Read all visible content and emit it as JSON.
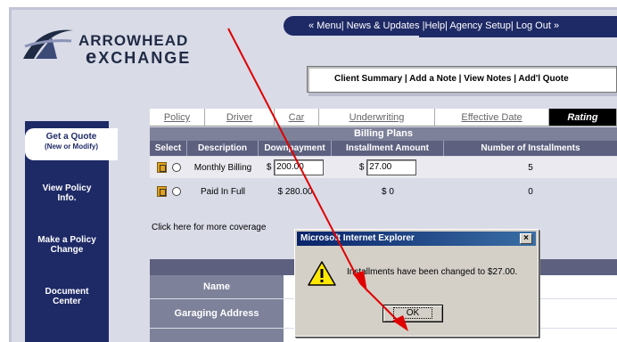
{
  "brand": {
    "line1": "ARROWHEAD",
    "line2": "xCHANGE",
    "line2_first": "e"
  },
  "top_menu": {
    "text": "« Menu| News & Updates |Help| Agency Setup| Log Out »"
  },
  "client_bar": {
    "text": "Client Summary | Add a Note | View Notes | Add'l Quote"
  },
  "sidebar": {
    "items": [
      {
        "label": "Get a Quote",
        "sub": "(New or Modify)"
      },
      {
        "label": "View Policy Info."
      },
      {
        "label": "Make a Policy Change"
      },
      {
        "label": "Document Center"
      }
    ]
  },
  "tabs": [
    {
      "label": "Policy"
    },
    {
      "label": "Driver"
    },
    {
      "label": "Car"
    },
    {
      "label": "Underwriting"
    },
    {
      "label": "Effective Date"
    },
    {
      "label": "Rating"
    }
  ],
  "billing": {
    "title": "Billing Plans",
    "columns": [
      "Select",
      "Description",
      "Downpayment",
      "Installment Amount",
      "Number of Installments"
    ],
    "rows": [
      {
        "description": "Monthly Billing",
        "currency": "$",
        "downpayment": "200.00",
        "installment_currency": "$",
        "installment": "27.00",
        "count": "5"
      },
      {
        "description": "Paid In Full",
        "downpayment_text": "$ 280.00",
        "installment_text": "$ 0",
        "count": "0"
      }
    ]
  },
  "click_here": "Click here for more coverage",
  "lower": {
    "rows": [
      {
        "label": "Name",
        "value": ""
      },
      {
        "label": "Garaging Address",
        "value": ""
      },
      {
        "label": "",
        "value": ""
      }
    ]
  },
  "dialog": {
    "title": "Microsoft Internet Explorer",
    "close": "×",
    "message": "Installments have been changed to $27.00.",
    "ok_label": "OK"
  },
  "colors": {
    "navy": "#1e2a66",
    "header": "#5d617f",
    "annotation": "#e00000"
  }
}
